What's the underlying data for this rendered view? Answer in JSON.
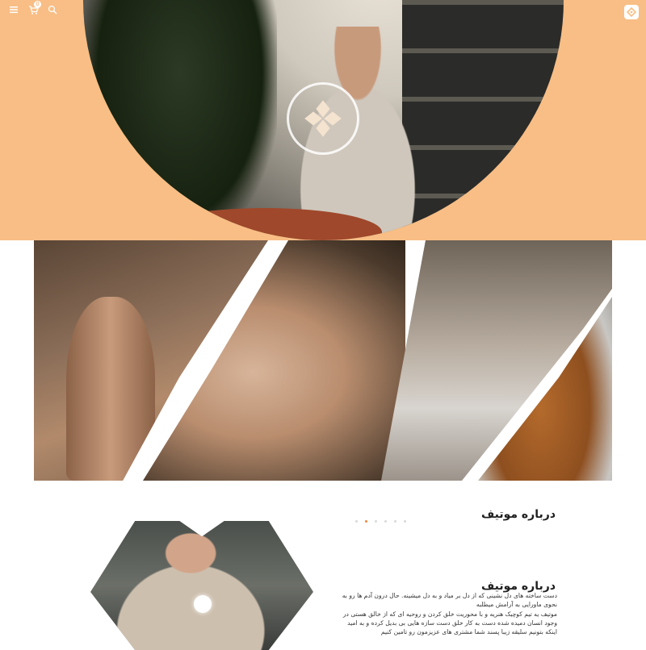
{
  "header": {
    "cart_count": "0",
    "icons": [
      "menu-icon",
      "cart-icon",
      "search-icon",
      "brand-logo-icon"
    ]
  },
  "hero": {
    "logo": "motif-logo-icon"
  },
  "collage": {
    "panels": [
      "pottery-wheel-vase",
      "hands-shaping-clay",
      "stacked-plates",
      "clay-bowl-glaze"
    ]
  },
  "about": {
    "title": "درباره موتیف",
    "title_2": "درباره موتیف",
    "paragraph_1": "دست ساخته های دل نشینی که از دل بر میاد و به دل میشینه. حال درون آدم ها رو به نحوی ماورایی به آرامش میطلبه",
    "paragraph_2": "موتیف یه تیم کوچیک هنریه و با محوریت خلق کردن و روحیه ای که از خالق هستی در وجود انسان دمیده شده دست به کار خلق دست سازه هایی بی بدیل کرده و به امید اینکه بتونیم سلیقه زیبا پسند شما مشتری های عزیزمون رو تامین کنیم",
    "slider_dots": 6,
    "active_dot": 1
  },
  "colors": {
    "accent": "#f8be85",
    "active_dot": "#e88a3f",
    "text": "#1f1f1f"
  }
}
